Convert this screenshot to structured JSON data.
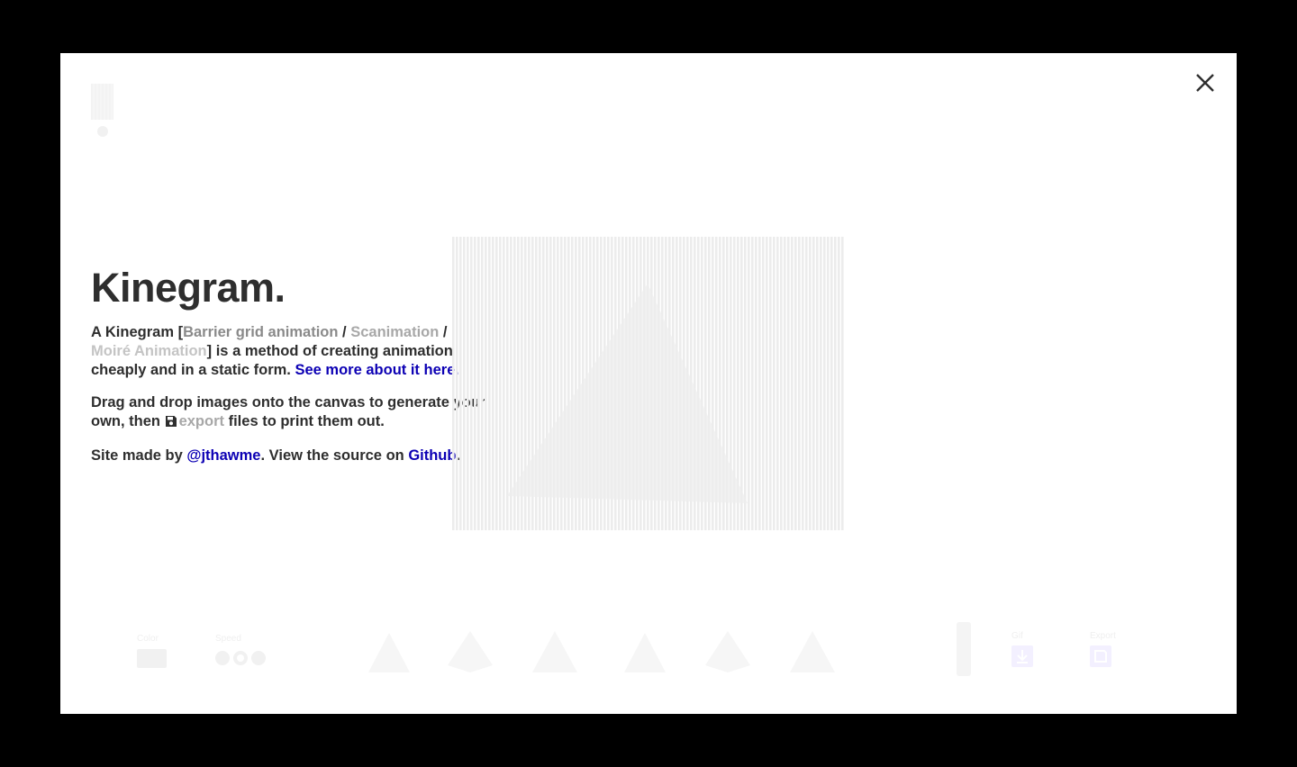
{
  "modal": {
    "title": "Kinegram.",
    "intro": {
      "lead": "A Kinegram [",
      "alt_name_1": "Barrier grid animation",
      "sep1": " / ",
      "alt_name_2": "Scanimation",
      "sep2": " / ",
      "alt_name_3": "Moiré Animation",
      "mid": "] is a method of creating animation cheaply and in a static form. ",
      "see_more_link": "See more about it here."
    },
    "drag": {
      "lead": "Drag and drop images onto the canvas to generate your own, then ",
      "export_link": "export",
      "tail": " files to print them out."
    },
    "credits": {
      "lead": "Site made by ",
      "author_link": "@jthawme",
      "mid": ". View the source on ",
      "source_link": "Github",
      "tail": "."
    }
  },
  "toolbar": {
    "color_label": "Color",
    "speed_label": "Speed",
    "gif_label": "Gif",
    "export_label": "Export"
  },
  "icons": {
    "close": "close-icon",
    "floppy": "floppy-disk-icon",
    "download": "download-icon",
    "save": "save-icon"
  },
  "colors": {
    "backdrop": "#000000",
    "text": "#2e2e2e",
    "link": "#0c00b4",
    "muted_1": "#8a8a8a",
    "muted_2": "#a8a8a8",
    "muted_3": "#c4c4c4"
  }
}
